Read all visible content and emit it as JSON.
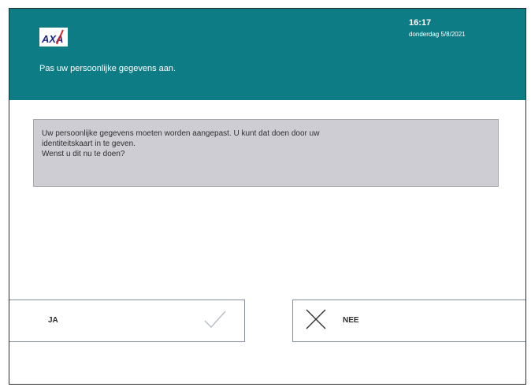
{
  "header": {
    "logo_text": "AXA",
    "title": "Pas uw persoonlijke gegevens aan.",
    "time": "16:17",
    "date": "donderdag 5/8/2021",
    "background_color": "#0d7c84"
  },
  "message": {
    "lines": [
      "Uw persoonlijke gegevens moeten worden aangepast. U kunt dat doen door uw",
      "identiteitskaart in te geven.",
      "Wenst u dit nu te doen?"
    ],
    "background_color": "#cfcdd4"
  },
  "buttons": {
    "yes": {
      "label": "JA",
      "icon": "check-icon"
    },
    "no": {
      "label": "NEE",
      "icon": "cross-icon"
    }
  }
}
